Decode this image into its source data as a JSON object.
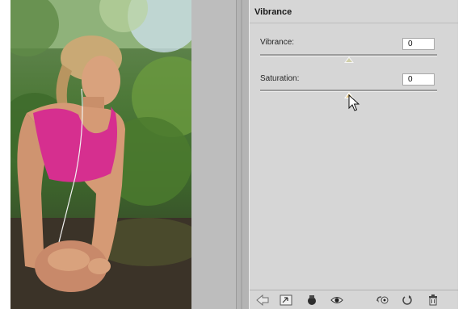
{
  "panel": {
    "title": "Vibrance",
    "vibrance": {
      "label": "Vibrance:",
      "value": "0",
      "level": 0.5
    },
    "saturation": {
      "label": "Saturation:",
      "value": "0",
      "level": 0.5
    }
  },
  "toolbar": {
    "icons": [
      "back-arrow-icon",
      "expand-view-icon",
      "clip-layer-icon",
      "visibility-eye-icon",
      "previous-state-icon",
      "reset-icon",
      "trash-icon"
    ]
  },
  "colors": {
    "panel_bg": "#d6d6d6",
    "accent_thumb": "#e6c98a",
    "photo_top": "#cfe2f0",
    "top_pink": "#d62f8f"
  }
}
